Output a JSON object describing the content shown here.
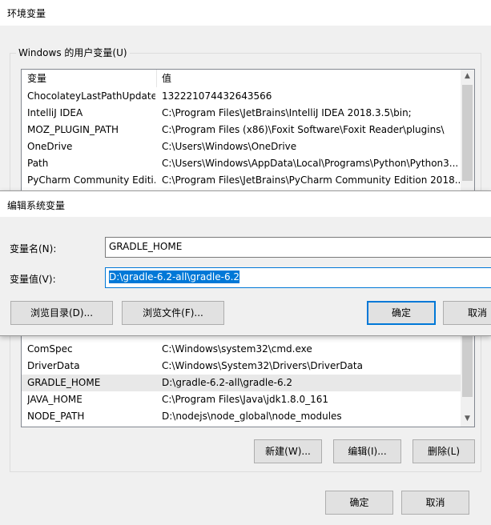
{
  "env_window": {
    "title": "环境变量",
    "user_group_label": "Windows 的用户变量(U)",
    "columns": [
      "变量",
      "值"
    ],
    "user_vars": [
      {
        "name": "ChocolateyLastPathUpdate",
        "value": "132221074432643566"
      },
      {
        "name": "IntelliJ IDEA",
        "value": "C:\\Program Files\\JetBrains\\IntelliJ IDEA 2018.3.5\\bin;"
      },
      {
        "name": "MOZ_PLUGIN_PATH",
        "value": "C:\\Program Files (x86)\\Foxit Software\\Foxit Reader\\plugins\\"
      },
      {
        "name": "OneDrive",
        "value": "C:\\Users\\Windows\\OneDrive"
      },
      {
        "name": "Path",
        "value": "C:\\Users\\Windows\\AppData\\Local\\Programs\\Python\\Python3..."
      },
      {
        "name": "PyCharm Community Editi...",
        "value": "C:\\Program Files\\JetBrains\\PyCharm Community Edition 2018...."
      }
    ],
    "system_vars": [
      {
        "name": "ComSpec",
        "value": "C:\\Windows\\system32\\cmd.exe"
      },
      {
        "name": "DriverData",
        "value": "C:\\Windows\\System32\\Drivers\\DriverData"
      },
      {
        "name": "GRADLE_HOME",
        "value": "D:\\gradle-6.2-all\\gradle-6.2"
      },
      {
        "name": "JAVA_HOME",
        "value": "C:\\Program Files\\Java\\jdk1.8.0_161"
      },
      {
        "name": "NODE_PATH",
        "value": "D:\\nodejs\\node_global\\node_modules"
      }
    ],
    "system_buttons": {
      "new": "新建(W)...",
      "edit": "编辑(I)...",
      "delete": "删除(L)"
    },
    "ok": "确定",
    "cancel": "取消"
  },
  "edit_dialog": {
    "title": "编辑系统变量",
    "name_label": "变量名(N):",
    "value_label": "变量值(V):",
    "name_value": "GRADLE_HOME",
    "value_value": "D:\\gradle-6.2-all\\gradle-6.2",
    "browse_dir": "浏览目录(D)...",
    "browse_file": "浏览文件(F)...",
    "ok": "确定",
    "cancel": "取消"
  },
  "colors": {
    "accent": "#0078d7",
    "selection": "#0078d7"
  }
}
